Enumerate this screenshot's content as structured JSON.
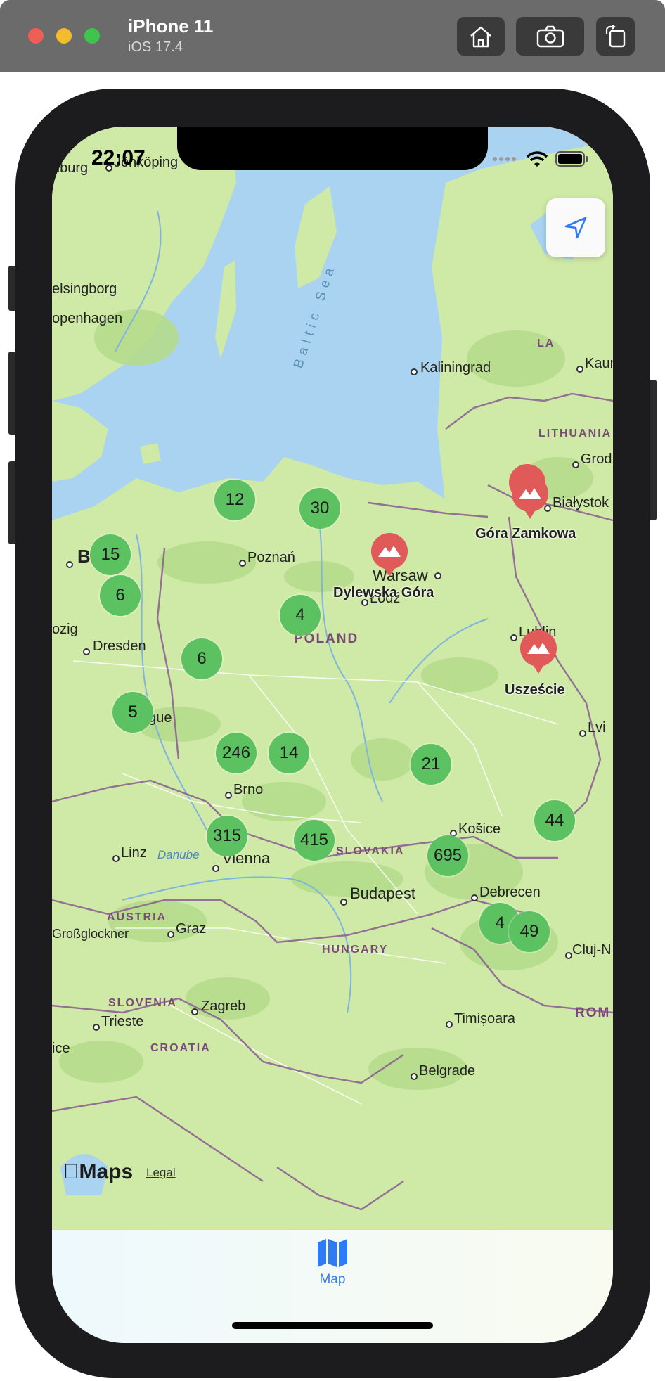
{
  "simulator": {
    "device": "iPhone 11",
    "os": "iOS 17.4",
    "buttons": [
      {
        "name": "home-icon"
      },
      {
        "name": "screenshot-icon"
      },
      {
        "name": "rotate-icon"
      }
    ]
  },
  "status_bar": {
    "time": "22:07",
    "icons": [
      "signal-icon",
      "wifi-icon",
      "battery-icon"
    ]
  },
  "map": {
    "sea_label": "Baltic Sea",
    "countries": [
      "LITHUANIA",
      "POLAND",
      "SLOVAKIA",
      "AUSTRIA",
      "HUNGARY",
      "SLOVENIA",
      "CROATIA",
      "ROM",
      "LA"
    ],
    "cities": [
      "Jönköping",
      "nburg",
      "elsingborg",
      "openhagen",
      "Kaliningrad",
      "Kaun",
      "Grod",
      "Białystok",
      "Berlin",
      "Poznań",
      "Warsaw",
      "Łódź",
      "Lublin",
      "ozig",
      "Dresden",
      "Prague",
      "Lvi",
      "Brno",
      "Košice",
      "Linz",
      "Vienna",
      "Danube",
      "Budapest",
      "Debrecen",
      "Großglockner",
      "Graz",
      "Cluj-N",
      "Zagreb",
      "Trieste",
      "Timișoara",
      "ice",
      "Belgrade"
    ],
    "clusters": [
      "12",
      "30",
      "15",
      "6",
      "4",
      "6",
      "5",
      "246",
      "14",
      "21",
      "315",
      "415",
      "695",
      "44",
      "4",
      "49"
    ],
    "peaks": [
      "Dylewska Góra",
      "Góra Zamkowa",
      "Uszeście"
    ],
    "attribution": {
      "logo": "Maps",
      "legal": "Legal"
    },
    "locate_button": {
      "icon": "location-arrow-icon"
    }
  },
  "tab_bar": {
    "tabs": [
      {
        "label": "Map",
        "icon": "map-icon",
        "selected": true
      }
    ]
  },
  "colors": {
    "accent": "#2f7af5",
    "cluster": "#5cc160",
    "peak_pin": "#e05a5a",
    "land": "#cfe9a6",
    "water": "#a9d3f0"
  }
}
